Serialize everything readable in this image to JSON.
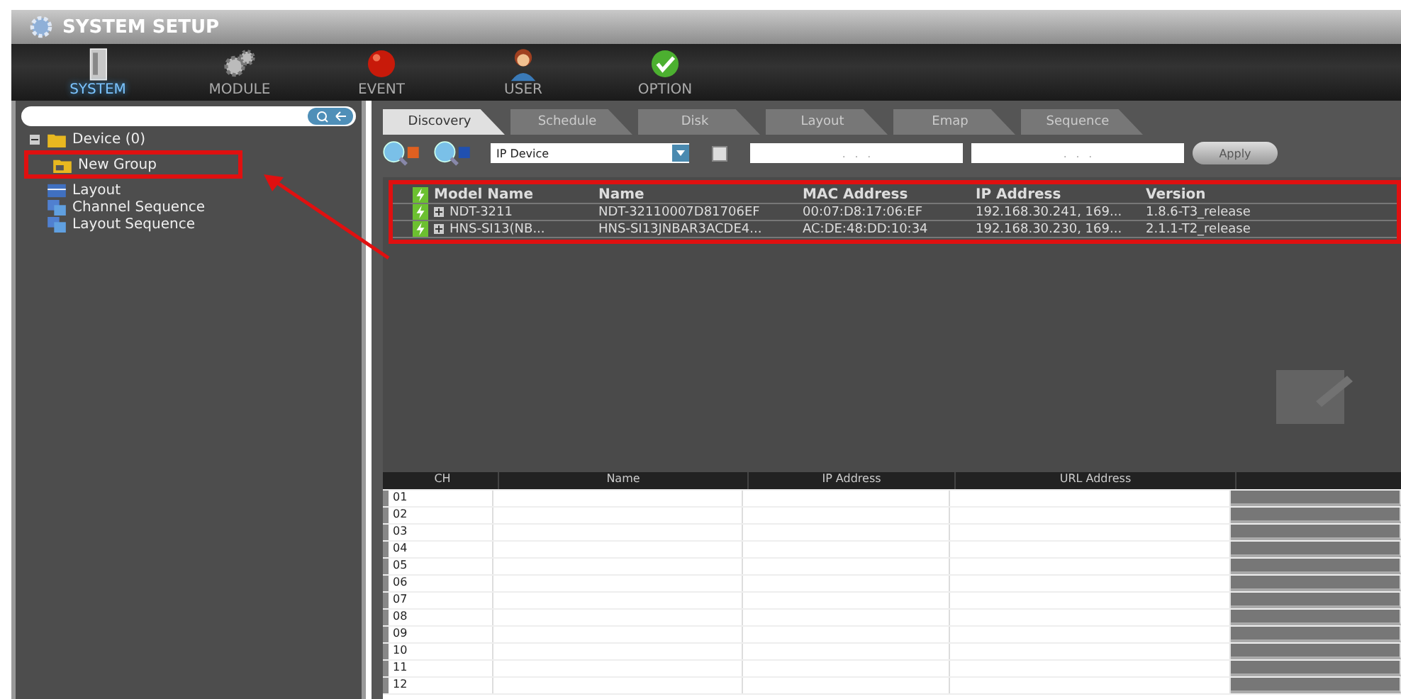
{
  "window": {
    "title": "SYSTEM SETUP"
  },
  "nav": [
    {
      "label": "SYSTEM",
      "kind": "server",
      "selected": true
    },
    {
      "label": "MODULE",
      "kind": "gears",
      "selected": false
    },
    {
      "label": "EVENT",
      "kind": "ball",
      "selected": false
    },
    {
      "label": "USER",
      "kind": "person",
      "selected": false
    },
    {
      "label": "OPTION",
      "kind": "check",
      "selected": false
    }
  ],
  "sidebar": {
    "tree": [
      {
        "label": "Device (0)",
        "kind": "folder",
        "expanded": true,
        "children": [
          {
            "label": "New Group",
            "kind": "group"
          }
        ]
      },
      {
        "label": "Layout",
        "kind": "layout"
      },
      {
        "label": "Channel Sequence",
        "kind": "sequence"
      },
      {
        "label": "Layout Sequence",
        "kind": "sequence"
      }
    ]
  },
  "tabs": [
    {
      "label": "Discovery",
      "selected": true
    },
    {
      "label": "Schedule",
      "selected": false
    },
    {
      "label": "Disk",
      "selected": false
    },
    {
      "label": "Layout",
      "selected": false
    },
    {
      "label": "Emap",
      "selected": false
    },
    {
      "label": "Sequence",
      "selected": false
    }
  ],
  "toolbar": {
    "device_type": "IP Device",
    "range_checked": false,
    "ip_from": ".   .   .",
    "ip_to": ".   .   .",
    "apply": "Apply"
  },
  "devices": {
    "columns": [
      "Model Name",
      "Name",
      "MAC Address",
      "IP Address",
      "Version"
    ],
    "rows": [
      {
        "expanded": false,
        "cells": [
          "NDT-3211",
          "NDT-32110007D81706EF",
          "00:07:D8:17:06:EF",
          "192.168.30.241, 169...",
          "1.8.6-T3_release"
        ]
      },
      {
        "expanded": false,
        "cells": [
          "HNS-SI13(NB...",
          "HNS-SI13JNBAR3ACDE4...",
          "AC:DE:48:DD:10:34",
          "192.168.30.230, 169...",
          "2.1.1-T2_release"
        ]
      }
    ]
  },
  "channels": {
    "columns": [
      "CH",
      "Name",
      "IP Address",
      "URL Address"
    ],
    "rows": [
      "01",
      "02",
      "03",
      "04",
      "05",
      "06",
      "07",
      "08",
      "09",
      "10",
      "11",
      "12"
    ]
  }
}
